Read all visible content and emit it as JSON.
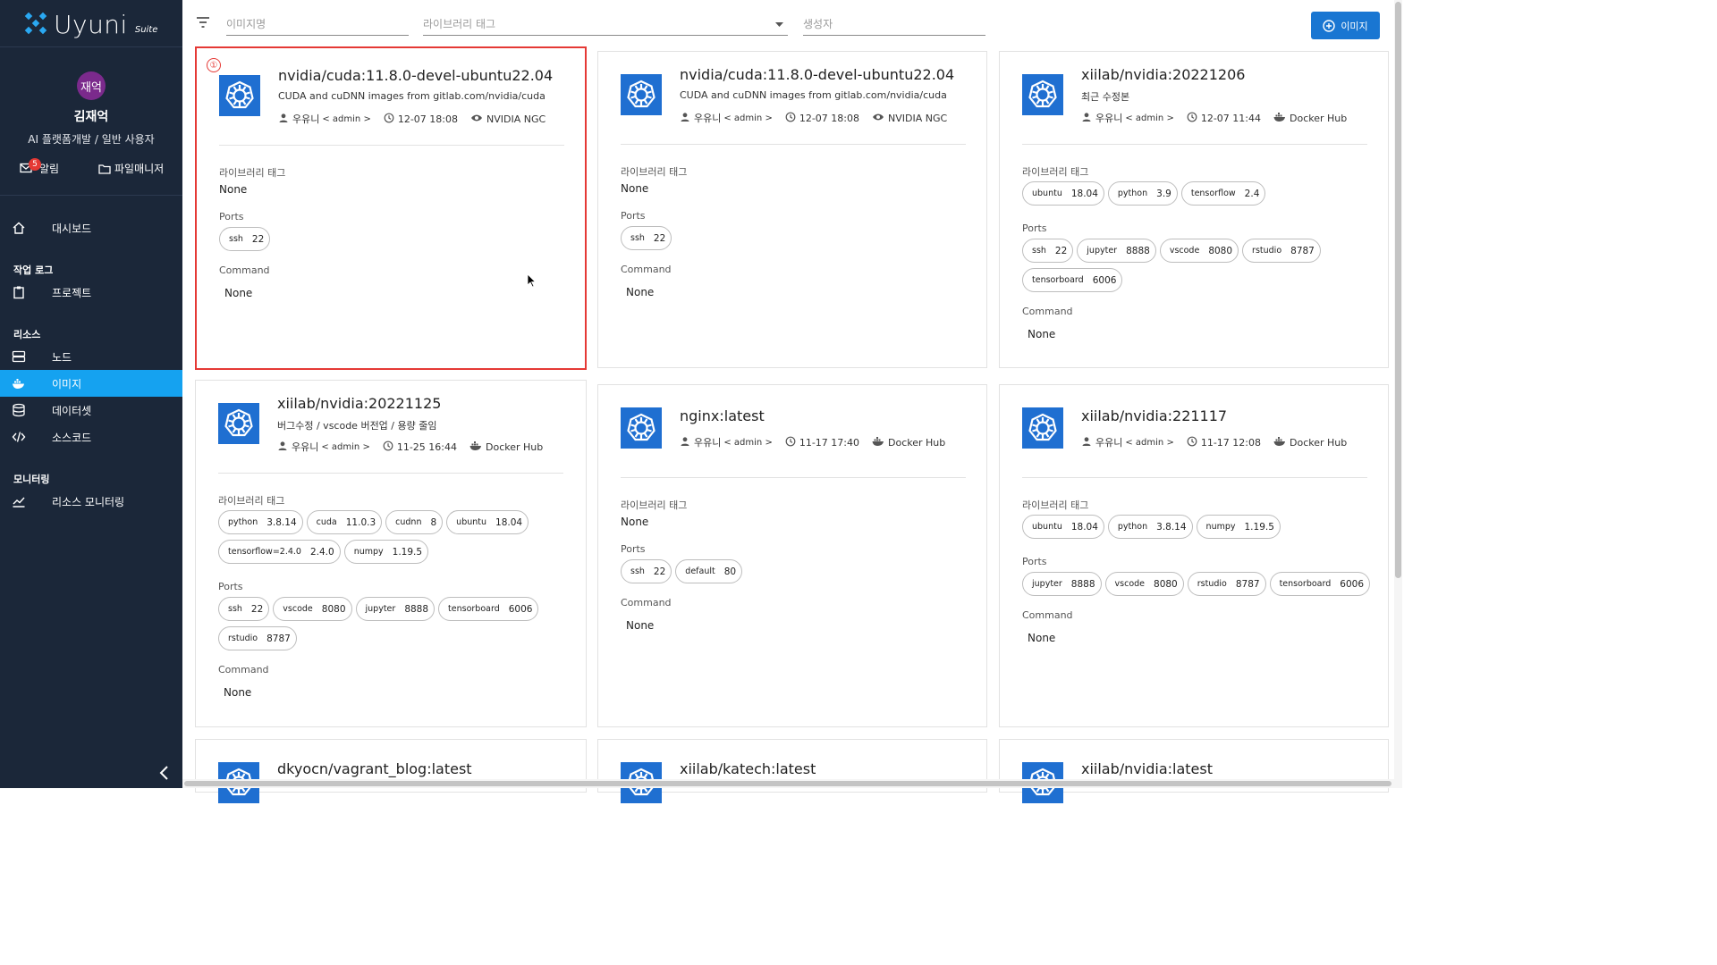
{
  "sidebar": {
    "logo_text": "Uyuni",
    "logo_suite": "Suite",
    "avatar_text": "재억",
    "user_name": "김재억",
    "user_role": "AI 플랫폼개발 / 일반 사용자",
    "alerts_label": "알림",
    "alerts_count": "5",
    "files_label": "파일매니저",
    "nav": {
      "dashboard": "대시보드",
      "sec_worklog": "작업 로그",
      "project": "프로젝트",
      "sec_resource": "리소스",
      "node": "노드",
      "image": "이미지",
      "dataset": "데이터셋",
      "source": "소스코드",
      "sec_monitoring": "모니터링",
      "resource_monitoring": "리소스 모니터링"
    },
    "accent": "#15a2f0",
    "bg": "#1b2739"
  },
  "filters": {
    "image_name_placeholder": "이미지명",
    "library_tag_placeholder": "라이브러리 태그",
    "creator_placeholder": "생성자",
    "add_button": "이미지"
  },
  "labels": {
    "library_tag": "라이브러리 태그",
    "ports": "Ports",
    "command": "Command"
  },
  "cards": [
    {
      "name": "nvidia/cuda:11.8.0-devel-ubuntu22.04",
      "desc": "CUDA and cuDNN images from gitlab.com/nvidia/cuda",
      "user": "우유니",
      "owner": "< admin >",
      "time": "12-07 18:08",
      "source": "NVIDIA NGC",
      "lib_value": "None",
      "libs": [],
      "ports": [
        {
          "k": "ssh",
          "v": "22"
        }
      ],
      "command": "None",
      "selected_marker": "①"
    },
    {
      "name": "nvidia/cuda:11.8.0-devel-ubuntu22.04",
      "desc": "CUDA and cuDNN images from gitlab.com/nvidia/cuda",
      "user": "우유니",
      "owner": "< admin >",
      "time": "12-07 18:08",
      "source": "NVIDIA NGC",
      "lib_value": "None",
      "libs": [],
      "ports": [
        {
          "k": "ssh",
          "v": "22"
        }
      ],
      "command": "None"
    },
    {
      "name": "xiilab/nvidia:20221206",
      "desc": "최근 수정본",
      "user": "우유니",
      "owner": "< admin >",
      "time": "12-07 11:44",
      "source": "Docker Hub",
      "libs": [
        {
          "k": "ubuntu",
          "v": "18.04"
        },
        {
          "k": "python",
          "v": "3.9"
        },
        {
          "k": "tensorflow",
          "v": "2.4"
        }
      ],
      "ports": [
        {
          "k": "ssh",
          "v": "22"
        },
        {
          "k": "jupyter",
          "v": "8888"
        },
        {
          "k": "vscode",
          "v": "8080"
        },
        {
          "k": "rstudio",
          "v": "8787"
        },
        {
          "k": "tensorboard",
          "v": "6006"
        }
      ],
      "command": "None"
    },
    {
      "name": "xiilab/nvidia:20221125",
      "desc": "버그수정 / vscode 버전업 / 용량 줄임",
      "user": "우유니",
      "owner": "< admin >",
      "time": "11-25 16:44",
      "source": "Docker Hub",
      "libs": [
        {
          "k": "python",
          "v": "3.8.14"
        },
        {
          "k": "cuda",
          "v": "11.0.3"
        },
        {
          "k": "cudnn",
          "v": "8"
        },
        {
          "k": "ubuntu",
          "v": "18.04"
        },
        {
          "k": "tensorflow=2.4.0",
          "v": "2.4.0"
        },
        {
          "k": "numpy",
          "v": "1.19.5"
        }
      ],
      "ports": [
        {
          "k": "ssh",
          "v": "22"
        },
        {
          "k": "vscode",
          "v": "8080"
        },
        {
          "k": "jupyter",
          "v": "8888"
        },
        {
          "k": "tensorboard",
          "v": "6006"
        },
        {
          "k": "rstudio",
          "v": "8787"
        }
      ],
      "command": "None"
    },
    {
      "name": "nginx:latest",
      "desc": "",
      "user": "우유니",
      "owner": "< admin >",
      "time": "11-17 17:40",
      "source": "Docker Hub",
      "lib_value": "None",
      "libs": [],
      "ports": [
        {
          "k": "ssh",
          "v": "22"
        },
        {
          "k": "default",
          "v": "80"
        }
      ],
      "command": "None"
    },
    {
      "name": "xiilab/nvidia:221117",
      "desc": "",
      "user": "우유니",
      "owner": "< admin >",
      "time": "11-17 12:08",
      "source": "Docker Hub",
      "libs": [
        {
          "k": "ubuntu",
          "v": "18.04"
        },
        {
          "k": "python",
          "v": "3.8.14"
        },
        {
          "k": "numpy",
          "v": "1.19.5"
        }
      ],
      "ports": [
        {
          "k": "jupyter",
          "v": "8888"
        },
        {
          "k": "vscode",
          "v": "8080"
        },
        {
          "k": "rstudio",
          "v": "8787"
        },
        {
          "k": "tensorboard",
          "v": "6006"
        }
      ],
      "command": "None"
    },
    {
      "name": "dkyocn/vagrant_blog:latest"
    },
    {
      "name": "xiilab/katech:latest"
    },
    {
      "name": "xiilab/nvidia:latest"
    }
  ]
}
